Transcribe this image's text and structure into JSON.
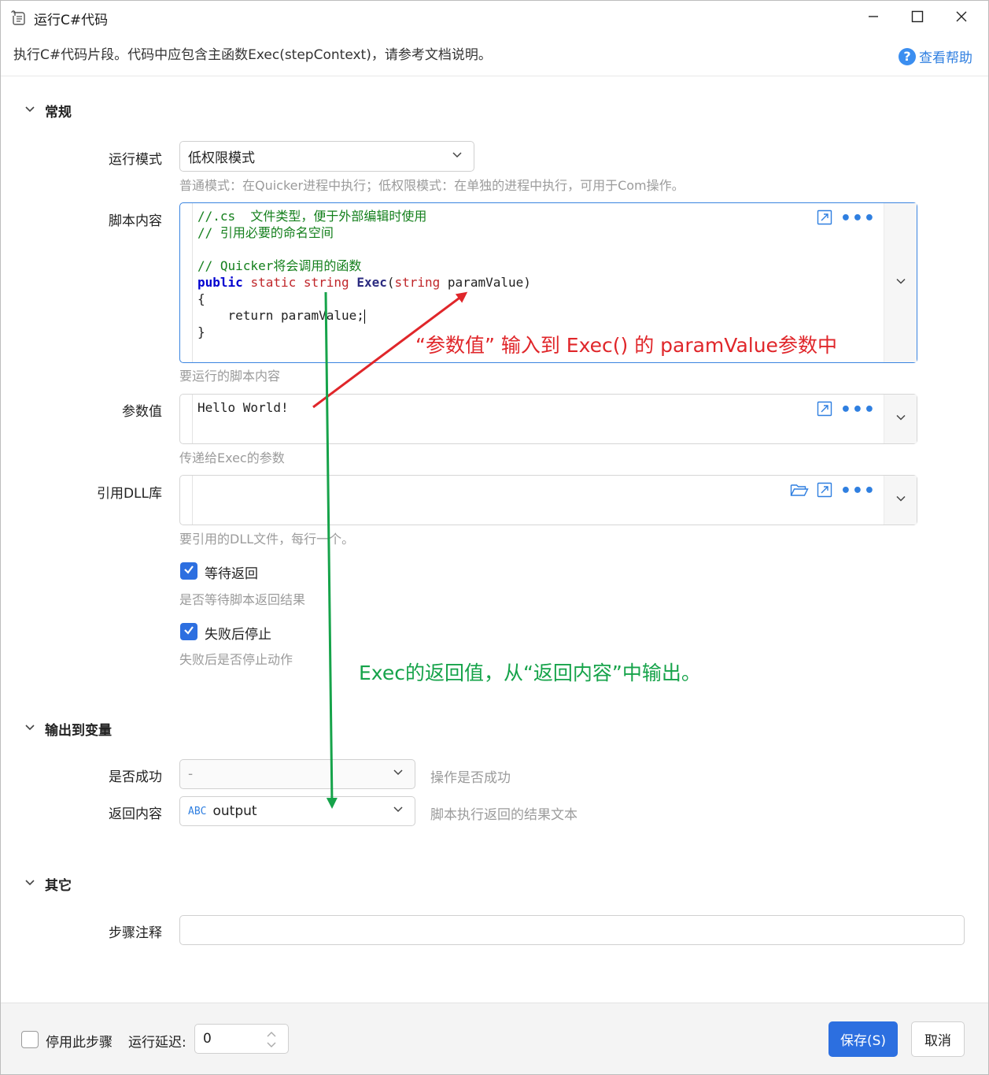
{
  "window": {
    "title": "运行C#代码",
    "description": "执行C#代码片段。代码中应包含主函数Exec(stepContext)，请参考文档说明。",
    "help_label": "查看帮助"
  },
  "sections": {
    "general": "常规",
    "output": "输出到变量",
    "other": "其它"
  },
  "run_mode": {
    "label": "运行模式",
    "value": "低权限模式",
    "hint": "普通模式：在Quicker进程中执行；低权限模式：在单独的进程中执行，可用于Com操作。"
  },
  "script": {
    "label": "脚本内容",
    "hint": "要运行的脚本内容",
    "lines": {
      "l1": "//.cs  文件类型，便于外部编辑时使用",
      "l2": "// 引用必要的命名空间",
      "l4": "// Quicker将会调用的函数",
      "l5_kw": "public",
      "l5_static": "static",
      "l5_type": "string",
      "l5_func": "Exec",
      "l5_open": "(",
      "l5_ptype": "string",
      "l5_rest": " paramValue)",
      "l6": "{",
      "l7_kw": "    return",
      "l7_rest": " paramValue;",
      "l8": "}"
    }
  },
  "param": {
    "label": "参数值",
    "value": "Hello World!",
    "hint": "传递给Exec的参数"
  },
  "dll": {
    "label": "引用DLL库",
    "value": "",
    "hint": "要引用的DLL文件，每行一个。"
  },
  "wait_return": {
    "label": "等待返回",
    "checked": true,
    "hint": "是否等待脚本返回结果"
  },
  "stop_on_fail": {
    "label": "失败后停止",
    "checked": true,
    "hint": "失败后是否停止动作"
  },
  "success_var": {
    "label": "是否成功",
    "value": "-",
    "hint": "操作是否成功"
  },
  "return_var": {
    "label": "返回内容",
    "type_badge": "ABC",
    "value": "output",
    "hint": "脚本执行返回的结果文本"
  },
  "step_note": {
    "label": "步骤注释",
    "value": ""
  },
  "footer": {
    "disable_label": "停用此步骤",
    "disable_checked": false,
    "delay_label": "运行延迟:",
    "delay_value": "0",
    "save_label": "保存(S)",
    "cancel_label": "取消"
  },
  "annotations": {
    "red": "“参数值” 输入到 Exec() 的 paramValue参数中",
    "green": "Exec的返回值，从“返回内容”中输出。"
  },
  "colors": {
    "accent": "#2c6fe0",
    "annotation_red": "#e0262a",
    "annotation_green": "#16a34a",
    "code_comment": "#15801d",
    "code_keyword": "#0000d0",
    "code_type": "#c0262a"
  }
}
